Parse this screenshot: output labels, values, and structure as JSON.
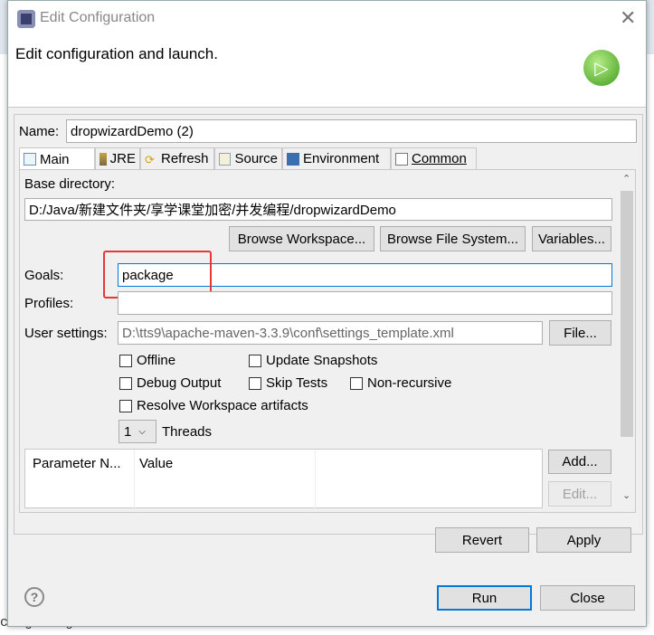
{
  "dialog": {
    "title": "Edit Configuration",
    "subtitle": "Edit configuration and launch.",
    "name_label": "Name:",
    "name_value": "dropwizardDemo (2)"
  },
  "tabs": [
    {
      "label": "Main",
      "icon": "main-tab-icon",
      "active": true
    },
    {
      "label": "JRE",
      "icon": "jre-icon"
    },
    {
      "label": "Refresh",
      "icon": "refresh-icon"
    },
    {
      "label": "Source",
      "icon": "source-icon"
    },
    {
      "label": "Environment",
      "icon": "environment-icon"
    },
    {
      "label": "Common",
      "icon": "common-icon"
    }
  ],
  "main": {
    "base_dir_label": "Base directory:",
    "base_dir_value": "D:/Java/新建文件夹/享学课堂加密/并发编程/dropwizardDemo",
    "browse_workspace": "Browse Workspace...",
    "browse_fs": "Browse File System...",
    "variables": "Variables...",
    "goals_label": "Goals:",
    "goals_value": "package",
    "profiles_label": "Profiles:",
    "profiles_value": "",
    "user_settings_label": "User settings:",
    "user_settings_value": "D:\\tts9\\apache-maven-3.3.9\\conf\\settings_template.xml",
    "file_button": "File...",
    "checkboxes": {
      "offline": "Offline",
      "update_snapshots": "Update Snapshots",
      "debug_output": "Debug Output",
      "skip_tests": "Skip Tests",
      "non_recursive": "Non-recursive",
      "resolve_workspace": "Resolve Workspace artifacts"
    },
    "threads_value": "1",
    "threads_label": "Threads",
    "table_headers": [
      "Parameter N...",
      "Value"
    ],
    "add_button": "Add...",
    "edit_button": "Edit..."
  },
  "buttons": {
    "revert": "Revert",
    "apply": "Apply",
    "run": "Run",
    "close": "Close"
  },
  "background": {
    "code_line": "cing original artifact with shaded artifact."
  },
  "colors": {
    "highlight": "#e53935",
    "focus": "#0078d7"
  }
}
